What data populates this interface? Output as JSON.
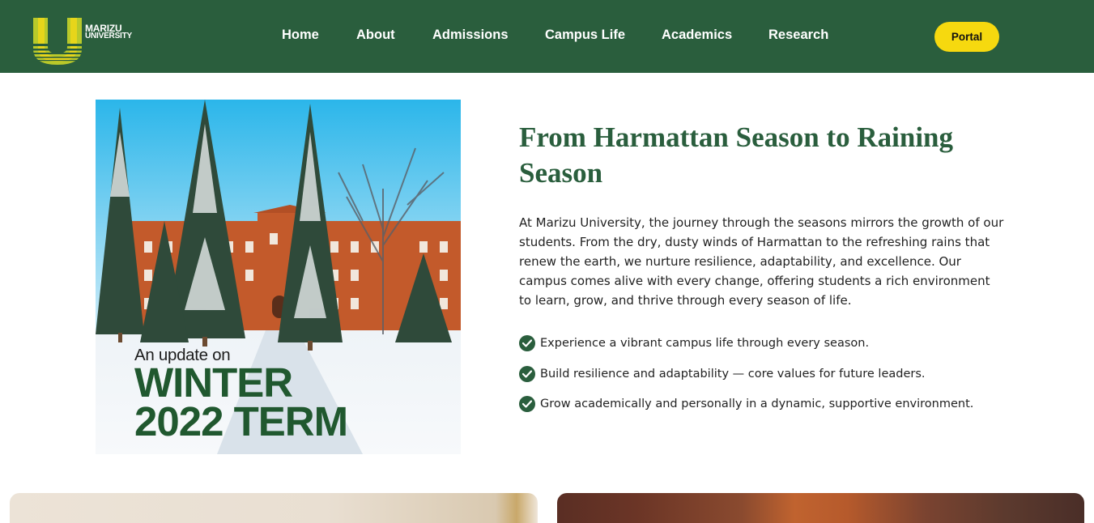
{
  "header": {
    "logo": {
      "mark_letter": "U",
      "line1": "MARIZU",
      "line2": "UNIVERSITY"
    },
    "nav": [
      {
        "label": "Home"
      },
      {
        "label": "About"
      },
      {
        "label": "Admissions"
      },
      {
        "label": "Campus Life"
      },
      {
        "label": "Academics"
      },
      {
        "label": "Research"
      }
    ],
    "portal_label": "Portal"
  },
  "hero_image": {
    "caption_small": "An update on",
    "caption_line1": "WINTER",
    "caption_line2": "2022 TERM"
  },
  "content": {
    "title": "From Harmattan Season to Raining Season",
    "description": "At Marizu University, the journey through the seasons mirrors the growth of our students. From the dry, dusty winds of Harmattan to the refreshing rains that renew the earth, we nurture resilience, adaptability, and excellence. Our campus comes alive with every change, offering students a rich environment to learn, grow, and thrive through every season of life.",
    "checklist": [
      {
        "text": "Experience a vibrant campus life through every season.",
        "icon": "check-circle-icon"
      },
      {
        "text": "Build resilience and adaptability — core values for future leaders.",
        "icon": "check-circle-icon"
      },
      {
        "text": "Grow academically and personally in a dynamic, supportive environment.",
        "icon": "check-circle-icon"
      }
    ]
  },
  "colors": {
    "brand_green": "#2a5e3d",
    "accent_yellow": "#f6d90f",
    "caption_green": "#20582f"
  }
}
